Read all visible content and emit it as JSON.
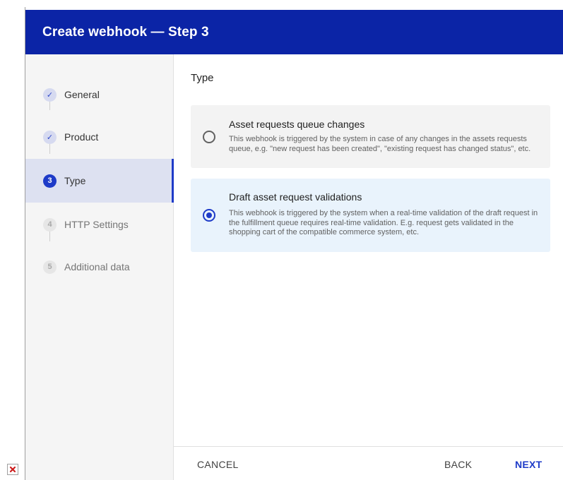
{
  "dialog": {
    "title": "Create webhook — Step 3"
  },
  "steps": [
    {
      "marker": "✓",
      "label": "General",
      "status": "done"
    },
    {
      "marker": "✓",
      "label": "Product",
      "status": "done"
    },
    {
      "marker": "3",
      "label": "Type",
      "status": "current"
    },
    {
      "marker": "4",
      "label": "HTTP Settings",
      "status": "todo"
    },
    {
      "marker": "5",
      "label": "Additional data",
      "status": "todo"
    }
  ],
  "content": {
    "section_title": "Type",
    "options": [
      {
        "title": "Asset requests queue changes",
        "description": "This webhook is triggered by the system in case of any changes in the assets requests queue, e.g. \"new request has been created\", \"existing request has changed status\", etc.",
        "selected": false
      },
      {
        "title": "Draft asset request validations",
        "description": "This webhook is triggered by the system when a real-time validation of the draft request in the fulfillment queue requires real-time validation. E.g. request gets validated in the shopping cart of the compatible commerce system, etc.",
        "selected": true
      }
    ]
  },
  "footer": {
    "cancel_label": "CANCEL",
    "back_label": "BACK",
    "next_label": "NEXT"
  },
  "colors": {
    "header_bg": "#0b24a6",
    "accent": "#1e3bc8",
    "sidebar_bg": "#f5f5f5",
    "active_step_bg": "#dde1f1",
    "selected_option_bg": "#e9f3fc"
  },
  "icons": {
    "broken_image": "broken-image-icon"
  }
}
